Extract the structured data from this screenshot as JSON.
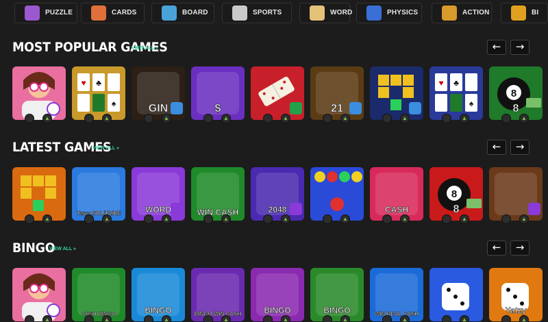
{
  "categories": [
    {
      "label": "PUZZLE",
      "icon": "puzzle-icon",
      "color": "#9b59d0"
    },
    {
      "label": "CARDS",
      "icon": "cards-icon",
      "color": "#e0703a"
    },
    {
      "label": "BOARD",
      "icon": "board-icon",
      "color": "#4aa3d8"
    },
    {
      "label": "SPORTS",
      "icon": "sports-icon",
      "color": "#c9c9c9"
    },
    {
      "label": "WORD",
      "icon": "word-icon",
      "color": "#e4c27a"
    },
    {
      "label": "PHYSICS",
      "icon": "physics-icon",
      "color": "#3a6fd8"
    },
    {
      "label": "ACTION",
      "icon": "action-icon",
      "color": "#d89a2a"
    },
    {
      "label": "BI",
      "icon": "bingo-icon",
      "color": "#e0a020"
    }
  ],
  "sections": [
    {
      "title": "MOST POPULAR GAMES",
      "view_all": "VIEW ALL »",
      "prev": "←",
      "next": "→",
      "games": [
        {
          "art": "character",
          "text": "",
          "bg": "#e96fa0",
          "badge": ""
        },
        {
          "art": "solitaire",
          "text": "",
          "bg": "#c99a2b",
          "badge": ""
        },
        {
          "art": "gin",
          "text": "GIN",
          "bg": "#2b1f16",
          "badge": "#3b8de0"
        },
        {
          "art": "dollar-tiles",
          "text": "$",
          "bg": "#6a2fc0",
          "badge": ""
        },
        {
          "art": "dominoes",
          "text": "",
          "bg": "#c8202a",
          "badge": "#22a04a"
        },
        {
          "art": "twenty-one",
          "text": "21",
          "bg": "#5a3b14",
          "badge": "#3b8de0"
        },
        {
          "art": "blocks",
          "text": "",
          "bg": "#1a2a6a",
          "badge": "#3b8de0"
        },
        {
          "art": "solitaire-blue",
          "text": "",
          "bg": "#2a3a9a",
          "badge": ""
        },
        {
          "art": "pool",
          "text": "8",
          "bg": "#1f7a2a",
          "badge": ""
        }
      ]
    },
    {
      "title": "LATEST GAMES",
      "view_all": "VIEW ALL »",
      "prev": "←",
      "next": "→",
      "games": [
        {
          "art": "block-puzzle",
          "text": "",
          "bg": "#d96a10",
          "badge": ""
        },
        {
          "art": "yatzy",
          "text": "Yatzy SOLITAIRE",
          "bg": "#2a7ae0",
          "badge": ""
        },
        {
          "art": "word-coin",
          "text": "WORD",
          "bg": "#8a3ad8",
          "badge": "#8a3ad8"
        },
        {
          "art": "win-cash",
          "text": "WIN CASH",
          "bg": "#1f8a2a",
          "badge": ""
        },
        {
          "art": "2048",
          "text": "2048",
          "bg": "#4a2ab0",
          "badge": "#8a3ad8"
        },
        {
          "art": "bubbles",
          "text": "",
          "bg": "#2a4ad8",
          "badge": ""
        },
        {
          "art": "candy-cash",
          "text": "CASH",
          "bg": "#d82a5a",
          "badge": ""
        },
        {
          "art": "pool-red",
          "text": "8",
          "bg": "#c81a1a",
          "badge": ""
        },
        {
          "art": "jewel",
          "text": "",
          "bg": "#6a3a1a",
          "badge": "#8a3ad8"
        }
      ]
    },
    {
      "title": "BINGO",
      "view_all": "VIEW ALL »",
      "prev": "←",
      "next": "→",
      "games": [
        {
          "art": "character",
          "text": "",
          "bg": "#e96fa0",
          "badge": ""
        },
        {
          "art": "cash-bingo",
          "text": "CA$H BINGO",
          "bg": "#1f8a2a",
          "badge": ""
        },
        {
          "art": "bingo-coin",
          "text": "BINGO",
          "bg": "#1a8ad8",
          "badge": ""
        },
        {
          "art": "bingo-win",
          "text": "BINGO WIN CASH",
          "bg": "#6a2ab0",
          "badge": ""
        },
        {
          "art": "bingo-purple",
          "text": "BINGO",
          "bg": "#8a2ab0",
          "badge": ""
        },
        {
          "art": "bingo-green",
          "text": "BINGO",
          "bg": "#2a8a2a",
          "badge": ""
        },
        {
          "art": "win-real-cash",
          "text": "WIN REAL CASH",
          "bg": "#1a6ad8",
          "badge": ""
        },
        {
          "art": "dice",
          "text": "",
          "bg": "#2a5ae0",
          "badge": ""
        },
        {
          "art": "yatzy-dice",
          "text": "Yatzy",
          "bg": "#e07a10",
          "badge": ""
        }
      ]
    }
  ],
  "platform_icons": {
    "apple": "",
    "android": "▲"
  }
}
